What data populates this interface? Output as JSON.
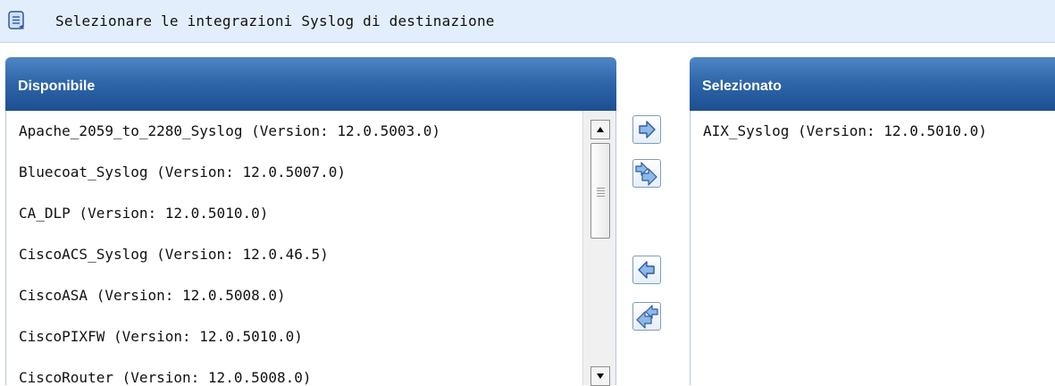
{
  "instruction": {
    "text": "Selezionare le integrazioni Syslog di destinazione",
    "icon": "notepad-icon"
  },
  "available": {
    "header": "Disponibile",
    "items": [
      "Apache_2059_to_2280_Syslog (Version: 12.0.5003.0)",
      "Bluecoat_Syslog (Version: 12.0.5007.0)",
      "CA_DLP (Version: 12.0.5010.0)",
      "CiscoACS_Syslog (Version: 12.0.46.5)",
      "CiscoASA (Version: 12.0.5008.0)",
      "CiscoPIXFW (Version: 12.0.5010.0)",
      "CiscoRouter (Version: 12.0.5008.0)"
    ]
  },
  "selected": {
    "header": "Selezionato",
    "items": [
      "AIX_Syslog (Version: 12.0.5010.0)"
    ]
  },
  "buttons": {
    "move_right": "arrow-right-icon",
    "move_all_right": "double-arrow-right-icon",
    "move_left": "arrow-left-icon",
    "move_all_left": "double-arrow-left-icon"
  },
  "colors": {
    "header_bg": "#2f67ab",
    "instruction_bg": "#e3eefc",
    "arrow_fill": "#8fb8e8"
  }
}
